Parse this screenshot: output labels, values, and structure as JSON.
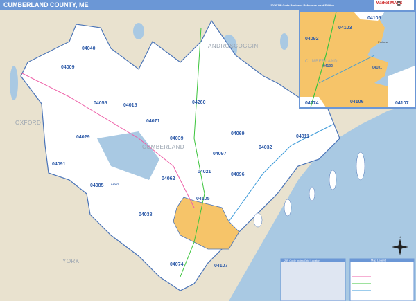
{
  "header": {
    "title": "CUMBERLAND COUNTY, ME",
    "edition": "2026 ZIP Code Business Reference Inset Edition",
    "logo": "Market MAPS"
  },
  "colors": {
    "header": "#6b97d6",
    "land": "#e9e2cf",
    "water": "#a9c9e3",
    "county": "#ffffff",
    "portland": "#f6c469",
    "boundary": "#4a74b8"
  },
  "counties": [
    "ANDROSCOGGIN",
    "OXFORD",
    "YORK",
    "CUMBERLAND"
  ],
  "zips": [
    "04040",
    "04009",
    "04055",
    "04015",
    "04071",
    "04260",
    "04039",
    "04069",
    "04032",
    "04011",
    "04029",
    "04091",
    "04097",
    "04021",
    "04096",
    "04062",
    "04085",
    "04105",
    "04038",
    "04074",
    "04107",
    "04057"
  ],
  "inset": {
    "zips": [
      "04105",
      "04103",
      "04092",
      "04102",
      "04101",
      "04074",
      "04106",
      "04107"
    ],
    "city": "Portland",
    "county": "CUMBERLAND"
  },
  "legend": {
    "index_title": "ZIP Code Index/Grid Locator",
    "key_title": "Map Legend"
  },
  "compass": "N"
}
